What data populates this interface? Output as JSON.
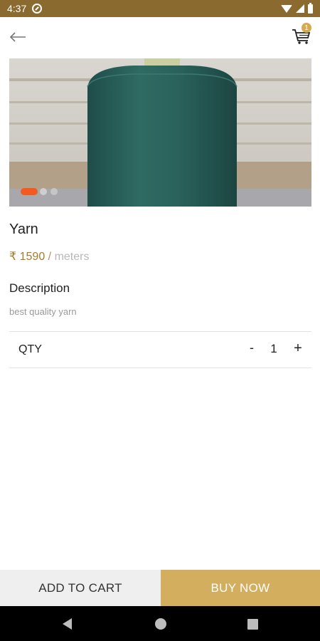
{
  "status_bar": {
    "time": "4:37"
  },
  "app_bar": {
    "cart_count": "1"
  },
  "product": {
    "name": "Yarn",
    "price": "₹ 1590",
    "separator": "/",
    "unit": "meters",
    "image_slides": 3,
    "active_slide": 1
  },
  "description": {
    "heading": "Description",
    "text": "best quality yarn"
  },
  "quantity": {
    "label": "QTY",
    "minus": "-",
    "value": "1",
    "plus": "+"
  },
  "actions": {
    "add_to_cart": "ADD TO CART",
    "buy_now": "BUY NOW"
  },
  "colors": {
    "status_bar": "#8a6a2e",
    "accent": "#d4ae5f",
    "price": "#a77b2b",
    "active_dot": "#f25a22"
  }
}
